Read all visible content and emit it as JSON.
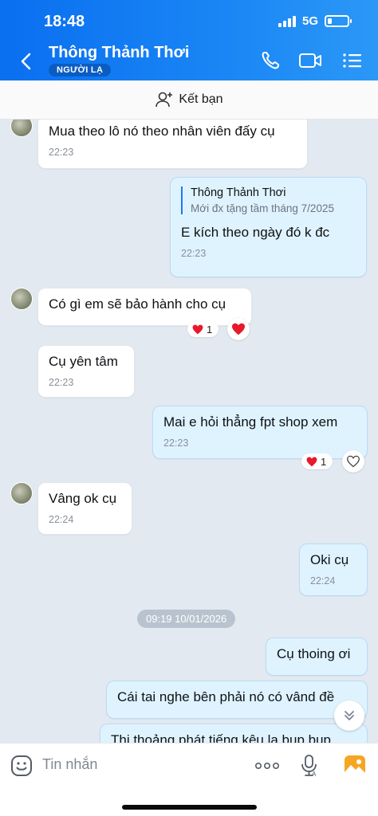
{
  "status_bar": {
    "time": "18:48",
    "network": "5G"
  },
  "header": {
    "contact_name": "Thông Thảnh Thơi",
    "badge": "NGƯỜI LẠ",
    "icons": [
      "back-icon",
      "phone-icon",
      "video-call-icon",
      "menu-icon"
    ],
    "gradient_colors": [
      "#0a6ff0",
      "#2b98f7"
    ]
  },
  "friend_bar": {
    "label": "Kết bạn",
    "icon": "add-friend-icon"
  },
  "messages": [
    {
      "text": "Mua theo lô nó theo nhân viên đấy cụ",
      "time": "22:23",
      "direction": "in"
    },
    {
      "quote_name": "Thông Thảnh Thơi",
      "quote_text": "Mới đx tặng tầm tháng 7/2025",
      "text": "E kích theo ngày đó k đc",
      "time": "22:23",
      "direction": "out"
    },
    {
      "text": "Có gì em sẽ bảo hành cho cụ",
      "reaction_count": "1",
      "direction": "in"
    },
    {
      "text": "Cụ yên tâm",
      "time": "22:23",
      "direction": "in"
    },
    {
      "text": "Mai e hỏi thẳng fpt shop xem",
      "time": "22:23",
      "reaction_count": "1",
      "direction": "out"
    },
    {
      "text": "Vâng ok cụ",
      "time": "22:24",
      "direction": "in"
    },
    {
      "text": "Oki cụ",
      "time": "22:24",
      "direction": "out"
    },
    {
      "text": "Cụ thoing ơi",
      "direction": "out"
    },
    {
      "text": "Cái tai nghe bên phải nó có vând đề",
      "direction": "out"
    },
    {
      "text": "Thi thoảng phát tiếng kêu lạ bụp bụp",
      "direction": "out"
    }
  ],
  "date_separator": "09:19 10/01/2026",
  "composer": {
    "placeholder": "Tin nhắn",
    "icons": [
      "emoji-icon",
      "more-icon",
      "mic-icon",
      "image-icon"
    ]
  },
  "colors": {
    "outgoing_bubble": "#dff3ff",
    "incoming_bubble": "#ffffff",
    "accent": "#1b78f0",
    "heart": "#e8192c"
  }
}
